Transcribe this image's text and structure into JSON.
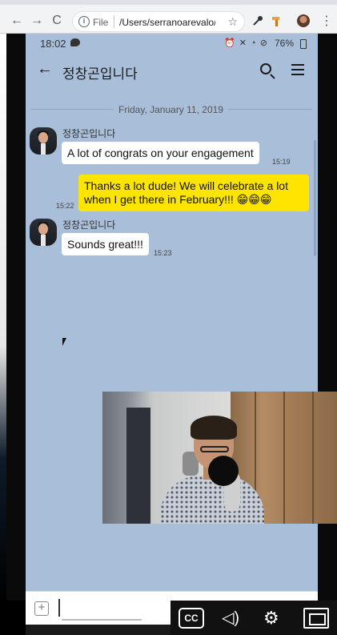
{
  "browser": {
    "back_icon": "←",
    "forward_icon": "→",
    "reload_icon": "C",
    "info_icon": "i",
    "scheme": "File",
    "url": "/Users/serranoarevalo/...",
    "star_icon": "☆",
    "menu_icon": "⋮"
  },
  "status_bar": {
    "time": "18:02",
    "icons": "⏰ ✕ ◔ ⊘",
    "battery": "76%"
  },
  "app_bar": {
    "back_icon": "←",
    "title": "정창곤입니다"
  },
  "chat": {
    "date": "Friday, January 11, 2019",
    "messages": [
      {
        "sender": "정창곤입니다",
        "text": "A lot of congrats on your engagement",
        "time": "15:19"
      },
      {
        "text": "Thanks a lot dude! We will celebrate a lot when I get there in February!!! 😁😁😁",
        "time": "15:22"
      },
      {
        "sender": "정창곤입니다",
        "text": "Sounds great!!!",
        "time": "15:23"
      }
    ]
  },
  "input": {
    "plus_icon": "+"
  },
  "player": {
    "cc_label": "CC",
    "volume_icon": "◁)",
    "settings_icon": "⚙"
  },
  "colors": {
    "chat_bg": "#a9bed8",
    "outgoing_bubble": "#fee500",
    "incoming_bubble": "#ffffff"
  }
}
